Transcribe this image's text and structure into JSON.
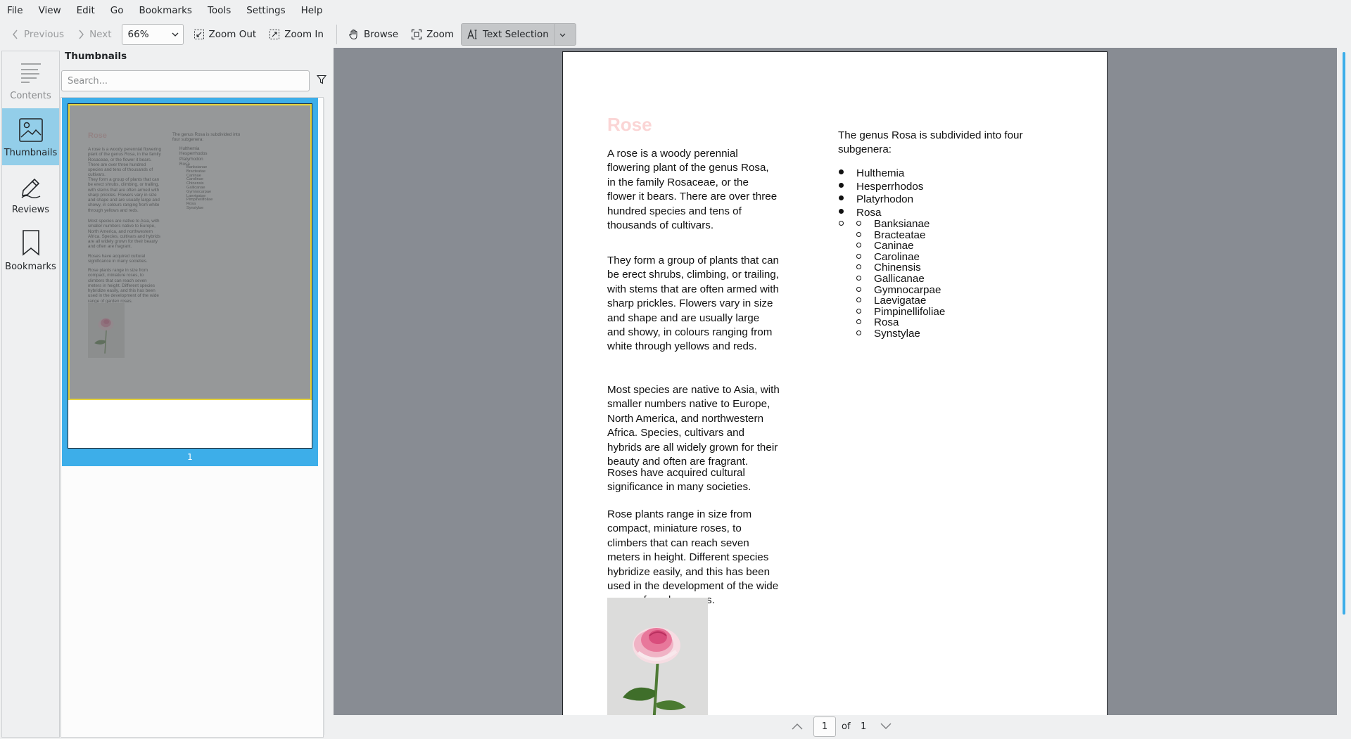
{
  "menu": [
    "File",
    "View",
    "Edit",
    "Go",
    "Bookmarks",
    "Tools",
    "Settings",
    "Help"
  ],
  "toolbar": {
    "previous": "Previous",
    "next": "Next",
    "zoom_value": "66%",
    "zoom_out": "Zoom Out",
    "zoom_in": "Zoom In",
    "browse": "Browse",
    "zoom": "Zoom",
    "text_selection": "Text Selection"
  },
  "sidebar_tabs": [
    {
      "label": "Contents",
      "icon": "contents-icon"
    },
    {
      "label": "Thumbnails",
      "icon": "thumbnails-icon",
      "selected": true
    },
    {
      "label": "Reviews",
      "icon": "reviews-icon"
    },
    {
      "label": "Bookmarks",
      "icon": "bookmarks-icon"
    }
  ],
  "thumbnails": {
    "title": "Thumbnails",
    "search_placeholder": "Search...",
    "page_label": "1"
  },
  "document": {
    "title": "Rose",
    "paragraphs": [
      "A rose is a woody perennial flowering plant of the genus Rosa, in the family Rosaceae, or the flower it bears. There are over three hundred species and tens of thousands of cultivars.",
      "They form a group of plants that can be erect shrubs, climbing, or trailing, with stems that are often armed with sharp prickles. Flowers vary in size and shape and are usually large and showy, in colours ranging from white through yellows and reds.",
      "Most species are native to Asia, with smaller numbers native to Europe, North America, and northwestern Africa. Species, cultivars and hybrids are all widely grown for their beauty and often are fragrant.",
      "Roses have acquired cultural significance in many societies.",
      "Rose plants range in size from compact, miniature roses, to climbers that can reach seven meters in height. Different species hybridize easily, and this has been used in the development of the wide range of garden roses."
    ],
    "right_intro": "The genus Rosa is subdivided into four subgenera:",
    "subgenera": [
      "Hulthemia",
      "Hesperrhodos",
      "Platyrhodon",
      "Rosa"
    ],
    "sections": [
      "Banksianae",
      "Bracteatae",
      "Caninae",
      "Carolinae",
      "Chinensis",
      "Gallicanae",
      "Gymnocarpae",
      "Laevigatae",
      "Pimpinellifoliae",
      "Rosa",
      "Synstylae"
    ]
  },
  "pager": {
    "current": "1",
    "of": "of",
    "total": "1"
  },
  "colors": {
    "accent": "#3daee9",
    "title_pink": "#fbd5d5",
    "view_bg": "#888c93"
  }
}
